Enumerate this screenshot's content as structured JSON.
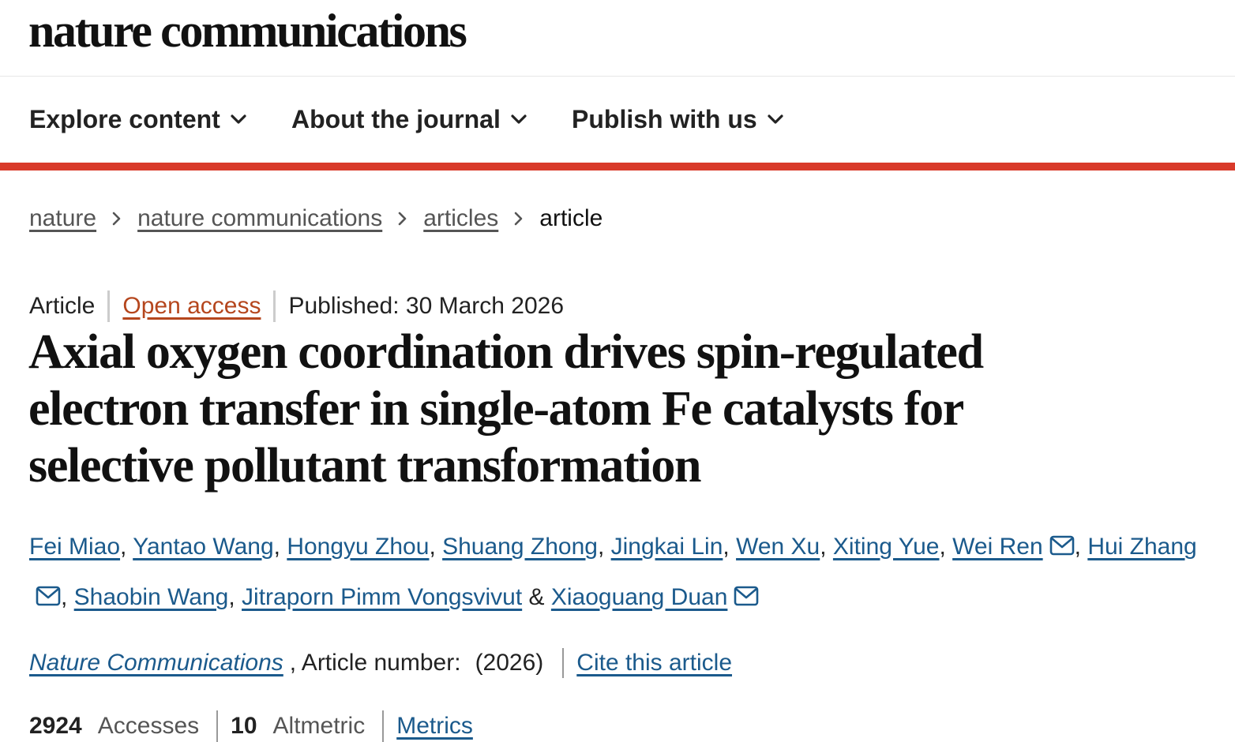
{
  "header": {
    "brand": "nature communications"
  },
  "nav": {
    "items": [
      {
        "label": "Explore content",
        "icon": "chevron-down-icon"
      },
      {
        "label": "About the journal",
        "icon": "chevron-down-icon"
      },
      {
        "label": "Publish with us",
        "icon": "chevron-down-icon"
      }
    ],
    "accent_color": "#d93a2a"
  },
  "breadcrumb": {
    "items": [
      "nature",
      "nature communications",
      "articles"
    ],
    "current": "article"
  },
  "meta": {
    "type": "Article",
    "access": "Open access",
    "published": "Published: 30 March 2026"
  },
  "article": {
    "title": "Axial oxygen coordination drives spin-regulated electron transfer in single-atom Fe catalysts for selective pollutant transformation"
  },
  "authors": [
    {
      "name": "Fei Miao",
      "sep": ", "
    },
    {
      "name": "Yantao Wang",
      "sep": ", "
    },
    {
      "name": "Hongyu Zhou",
      "sep": ", "
    },
    {
      "name": "Shuang Zhong",
      "sep": ", "
    },
    {
      "name": "Jingkai Lin",
      "sep": ", "
    },
    {
      "name": "Wen Xu",
      "sep": ", "
    },
    {
      "name": "Xiting Yue",
      "sep": ", "
    },
    {
      "name": "Wei Ren",
      "sep": ", ",
      "email_icon": "mail-icon"
    },
    {
      "name": "Hui Zhang",
      "sep": ", ",
      "email_icon": "mail-icon"
    },
    {
      "name": "Shaobin Wang",
      "sep": ", "
    },
    {
      "name": "Jitraporn Pimm Vongsvivut",
      "sep": " & "
    },
    {
      "name": "Xiaoguang Duan",
      "sep": "",
      "email_icon": "mail-icon"
    }
  ],
  "citation": {
    "journal": "Nature Communications",
    "article_number": ", Article number:",
    "year": "(2026)",
    "cite_label": "Cite this article"
  },
  "stats": {
    "accesses_count": "2924",
    "accesses_label": "Accesses",
    "altmetric_count": "10",
    "altmetric_label": "Altmetric",
    "metrics_label": "Metrics"
  },
  "colors": {
    "link": "#1b5a8c",
    "open_access": "#b5461d"
  }
}
